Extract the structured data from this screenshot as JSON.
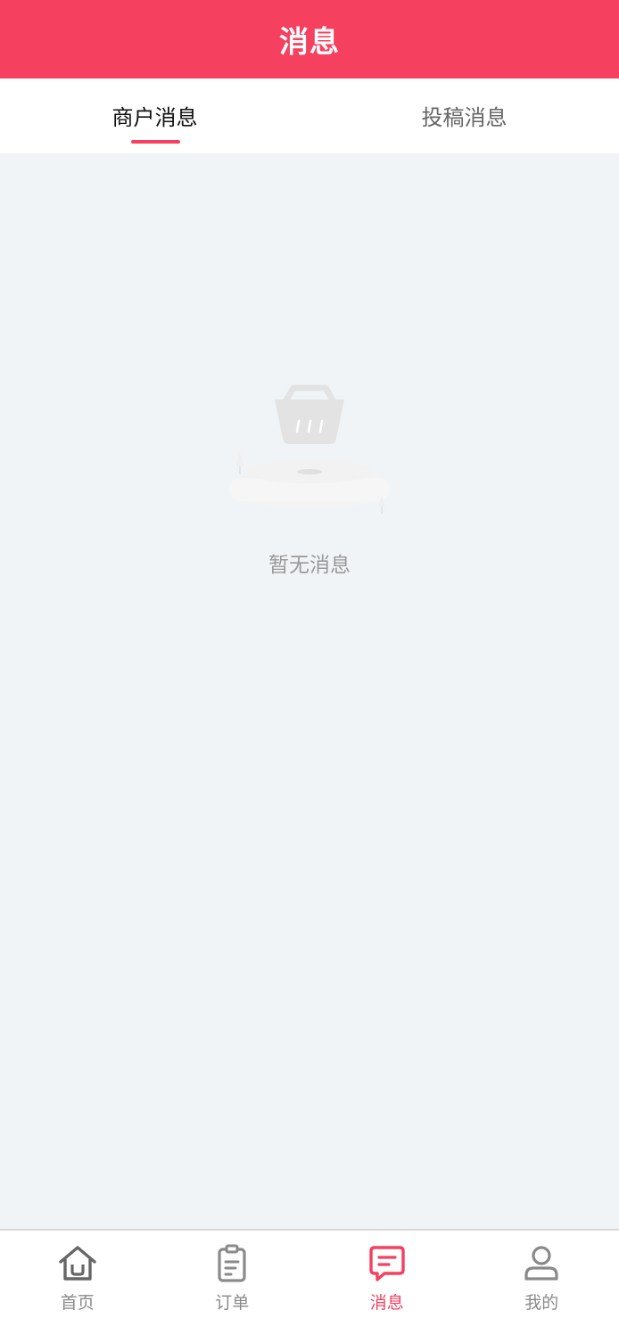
{
  "header": {
    "title": "消息"
  },
  "tabs": [
    {
      "label": "商户消息",
      "active": true
    },
    {
      "label": "投稿消息",
      "active": false
    }
  ],
  "empty_state": {
    "text": "暂无消息",
    "icon": "empty-basket-icon"
  },
  "tabbar": [
    {
      "label": "首页",
      "icon": "home-icon",
      "active": false
    },
    {
      "label": "订单",
      "icon": "clipboard-icon",
      "active": false
    },
    {
      "label": "消息",
      "icon": "message-icon",
      "active": true
    },
    {
      "label": "我的",
      "icon": "user-icon",
      "active": false
    }
  ],
  "colors": {
    "accent": "#f5405f",
    "background": "#f1f4f7",
    "inactive": "#8a8a8a"
  }
}
